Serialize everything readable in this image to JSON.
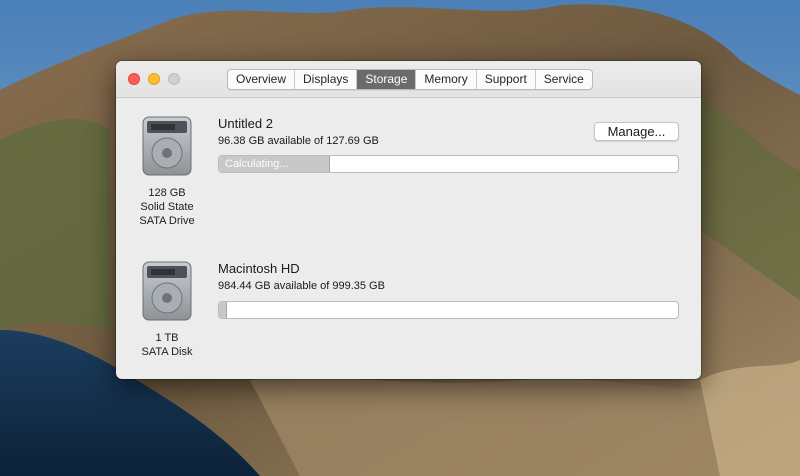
{
  "window": {
    "tabs": [
      {
        "label": "Overview"
      },
      {
        "label": "Displays"
      },
      {
        "label": "Storage"
      },
      {
        "label": "Memory"
      },
      {
        "label": "Support"
      },
      {
        "label": "Service"
      }
    ],
    "active_tab": "Storage"
  },
  "drives": [
    {
      "caption_lines": [
        "128 GB",
        "Solid State",
        "SATA Drive"
      ],
      "volume_name": "Untitled 2",
      "available_text": "96.38 GB available of 127.69 GB",
      "bar_text": "Calculating...",
      "bar_fill_fraction": 0.24,
      "manage_label": "Manage..."
    },
    {
      "caption_lines": [
        "1 TB",
        "SATA Disk"
      ],
      "volume_name": "Macintosh HD",
      "available_text": "984.44 GB available of 999.35 GB",
      "bar_fill_fraction": 0.015
    }
  ],
  "colors": {
    "tab_active": "#6b6b6b",
    "close": "#fe5f57",
    "minimize": "#febc2e",
    "zoom": "#d0d0d0"
  }
}
